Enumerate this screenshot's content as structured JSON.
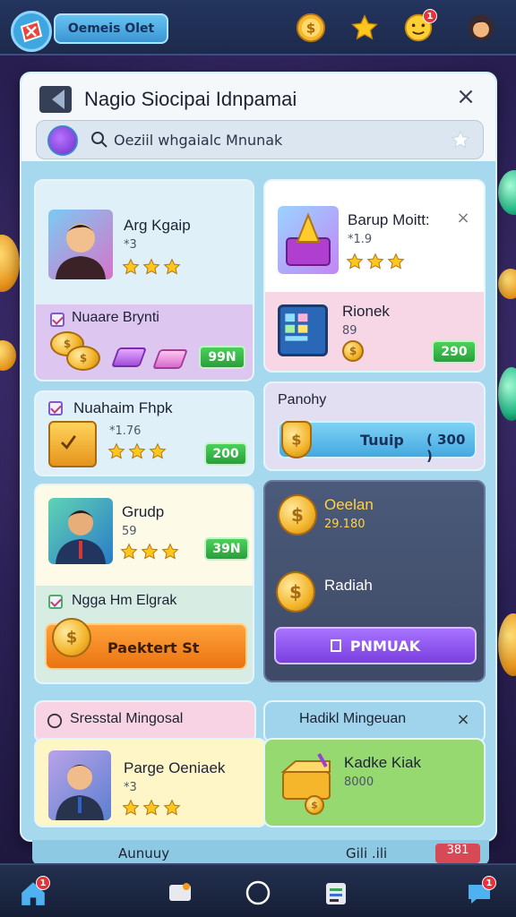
{
  "top_bar": {
    "pill_label": "Oemeis Olet",
    "notification_count": "1"
  },
  "panel": {
    "title": "Nagio Siocipai Idnpamai",
    "search_placeholder": "Oeziil whgaialc Mnunak"
  },
  "cards": {
    "arg": {
      "name": "Arg Kgaip",
      "sub": "*3",
      "rating": 3
    },
    "nuaare": {
      "label": "Nuaare Brynti",
      "price": "99N"
    },
    "barup": {
      "name": "Barup Moitt:",
      "sub": "*1.9",
      "rating": 3
    },
    "rionek": {
      "name": "Rionek",
      "sub": "89",
      "price": "290"
    },
    "nuahaim": {
      "name": "Nuahaim Fhpk",
      "sub": "*1.76",
      "rating": 3,
      "price": "200"
    },
    "panohy": {
      "label": "Panohy",
      "button_label": "Tuuip",
      "button_value": "( 300 )"
    },
    "grudp": {
      "name": "Grudp",
      "sub": "59",
      "rating": 3,
      "price": "39N"
    },
    "oeelan": {
      "name": "Oeelan",
      "value": "29.180",
      "radiah": "Radiah",
      "button_label": "PNMUAK"
    },
    "ngga": {
      "label": "Ngga Hm Elgrak",
      "button_label": "Paektert St"
    },
    "sresstal": {
      "label": "Sresstal Mingosal"
    },
    "hadikl": {
      "label": "Hadikl Mingeuan"
    },
    "parge": {
      "name": "Parge Oeniaek",
      "sub": "*3",
      "rating": 3
    },
    "kadke": {
      "name": "Kadke Kiak",
      "sub": "8000"
    },
    "peek": {
      "left": "Aunuuy",
      "right": "Gili .ili",
      "price": "381"
    }
  },
  "bottom_nav": {
    "home_badge": "1",
    "chat_badge": "1"
  },
  "colors": {
    "panel_bg": "#a6d9ee",
    "green_price": "#2a9e3b",
    "purple_button": "#8f55e6",
    "orange_button": "#f08a1f"
  }
}
